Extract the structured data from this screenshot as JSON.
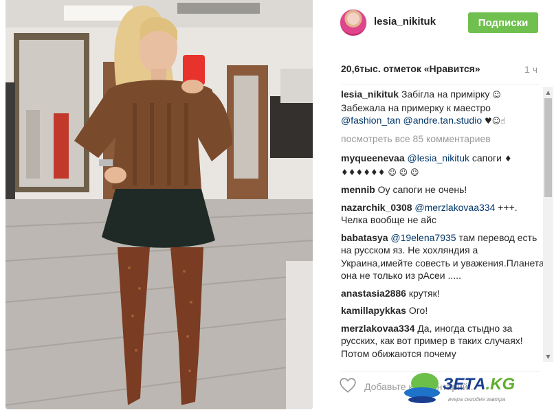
{
  "post": {
    "username": "lesia_nikituk",
    "follow_label": "Подписки",
    "likes": "20,6тыс. отметок «Нравится»",
    "time": "1 ч",
    "view_all": "посмотреть все 85 комментариев",
    "add_comment_placeholder": "Добавьте комментарий..."
  },
  "caption": {
    "user": "lesia_nikituk",
    "line1": "Забігла на примірку",
    "line2": "Забежала на примерку к маестро",
    "mention1": "@fashion_tan",
    "mention2": "@andre.tan.studio"
  },
  "comments": [
    {
      "user": "myqueenevaa",
      "mention": "@lesia_nikituk",
      "text": "сапоги"
    },
    {
      "user": "mennib",
      "mention": "",
      "text": "Оу сапоги не очень!"
    },
    {
      "user": "nazarchik_0308",
      "mention": "@merzlakovaa334",
      "text": "+++. Челка вообще не айс"
    },
    {
      "user": "babatasya",
      "mention": "@19elena7935",
      "text": "там перевод есть на русском яз. Не хохляндия а Украина,имейте совесть и уважения.Планета она не только из рАсеи ....."
    },
    {
      "user": "anastasia2886",
      "mention": "",
      "text": "крутяк!"
    },
    {
      "user": "kamillapykkas",
      "mention": "",
      "text": "Ого!"
    },
    {
      "user": "merzlakovaa334",
      "mention": "",
      "text": "Да, иногда стыдно за русских, как вот пример в таких случаях! Потом обижаются почему"
    }
  ],
  "watermark": {
    "brand": "ЗЕТА",
    "tld": ".KG",
    "tagline": "вчера сегодня завтра"
  },
  "colors": {
    "follow_button": "#70c050",
    "mention": "#003569",
    "muted": "#999999"
  },
  "icons": {
    "heart": "heart-outline-icon",
    "scroll_up": "chevron-up-icon",
    "scroll_down": "chevron-down-icon"
  }
}
